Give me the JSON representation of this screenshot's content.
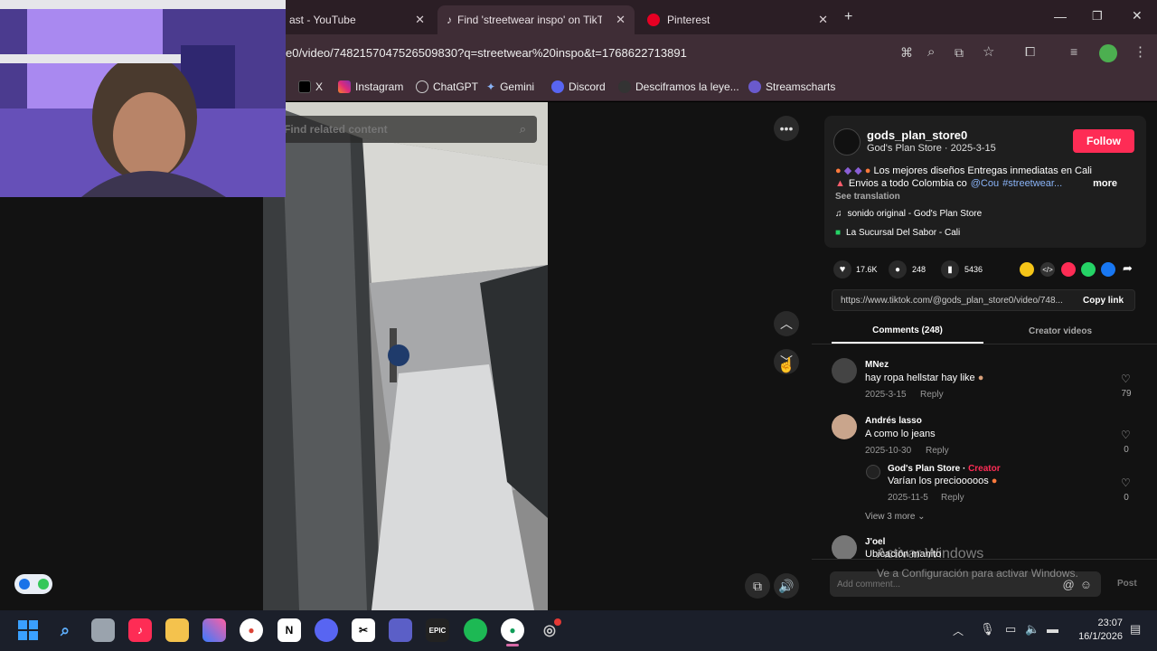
{
  "browser": {
    "tabs": [
      {
        "label": "ast - YouTube"
      },
      {
        "label": "Find 'streetwear inspo' on TikTo"
      },
      {
        "label": "Pinterest"
      }
    ],
    "url": "e0/video/7482157047526509830?q=streetwear%20inspo&t=1768622713891",
    "bookmarks": [
      {
        "label": "X"
      },
      {
        "label": "Instagram"
      },
      {
        "label": "ChatGPT"
      },
      {
        "label": "Gemini"
      },
      {
        "label": "Discord"
      },
      {
        "label": "Desciframos la leye..."
      },
      {
        "label": "Streamscharts"
      }
    ]
  },
  "search": {
    "placeholder": "Find related content"
  },
  "post": {
    "username": "gods_plan_store0",
    "subline": "God's Plan Store · 2025-3-15",
    "follow_label": "Follow",
    "caption_line1": "Los mejores diseños Entregas inmediatas en Cali",
    "caption_line2_prefix": "Envios a todo Colombia co",
    "caption_mention": "@Cou",
    "caption_hashtag": "#streetwear...",
    "more_label": "more",
    "see_translation": "See translation",
    "sound": "sonido original - God's Plan Store",
    "location": "La Sucursal Del Sabor - Cali",
    "likes": "17.6K",
    "comments_count": "248",
    "saves": "5436",
    "link": "https://www.tiktok.com/@gods_plan_store0/video/748...",
    "copy_link_label": "Copy link"
  },
  "tabs": {
    "comments": "Comments (248)",
    "creator_videos": "Creator videos"
  },
  "comments": [
    {
      "user": "MNez",
      "text": "hay ropa hellstar hay like",
      "date": "2025-3-15",
      "reply": "Reply",
      "likes": "79"
    },
    {
      "user": "Andrés lasso",
      "text": "A como lo jeans",
      "date": "2025-10-30",
      "reply": "Reply",
      "likes": "0"
    }
  ],
  "reply_comment": {
    "user": "God's Plan Store",
    "creator_tag": "Creator",
    "text": "Varían los preciooooos",
    "date": "2025-11-5",
    "reply": "Reply",
    "likes": "0"
  },
  "view_more": "View 3 more",
  "partial_comment": {
    "user": "J'oel",
    "text": "Ubicación manito"
  },
  "add_comment": {
    "placeholder": "Add comment...",
    "post_label": "Post"
  },
  "watermark": {
    "line1": "Activar Windows",
    "line2": "Ve a Configuración para activar Windows."
  },
  "taskbar": {
    "time": "23:07",
    "date": "16/1/2026"
  },
  "colors": {
    "follow": "#fe2c55",
    "hashtag": "#8ab4f8",
    "creator": "#fe2c55",
    "tabbar": "#2b1e25",
    "toolbar": "#3f2d36"
  }
}
